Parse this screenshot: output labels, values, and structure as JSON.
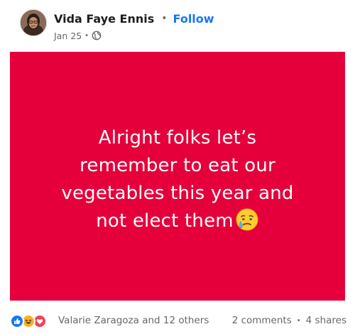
{
  "post": {
    "author": "Vida Faye Ennis",
    "follow_label": "Follow",
    "date": "Jan 25",
    "audience_icon": "globe-icon",
    "text_lines": [
      "Alright folks let’s",
      "remember to eat our",
      "vegetables this year and",
      "not elect them"
    ],
    "text_emoji": "crying-face-emoji",
    "background_color": "#e5003b"
  },
  "footer": {
    "reaction_icons": [
      "like-icon",
      "haha-icon",
      "love-icon"
    ],
    "reactors": "Valarie Zaragoza and 12 others",
    "comments": "2 comments",
    "shares": "4 shares"
  }
}
